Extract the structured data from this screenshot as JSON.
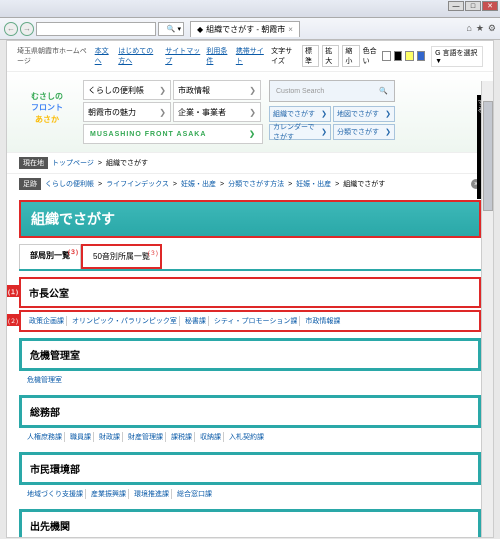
{
  "window": {
    "min": "—",
    "max": "□",
    "close": "✕"
  },
  "tab": {
    "title": "組織でさがす - 朝霞市",
    "close": "×"
  },
  "toolbar": {
    "search_icon": "🔍 ▾",
    "home": "⌂",
    "star": "★",
    "gear": "⚙"
  },
  "topbar": {
    "site_name": "埼玉県朝霞市ホームページ",
    "links": [
      "本文へ",
      "はじめての方へ",
      "サイトマップ",
      "利用条件",
      "携帯サイト"
    ],
    "font_label": "文字サイズ",
    "fonts": [
      "標準",
      "拡大",
      "縮小"
    ],
    "color_label": "色合い",
    "colors": [
      "#fff",
      "#000",
      "#ffff66",
      "#3366cc"
    ],
    "google": "G 言語を選択 ▼"
  },
  "logo": {
    "l1": "むさしの",
    "l2": "フロント",
    "l3": "あさか"
  },
  "nav": [
    [
      "くらしの便利帳",
      "市政情報"
    ],
    [
      "朝霞市の魅力",
      "企業・事業者"
    ]
  ],
  "musashino": "MUSASHINO FRONT ASAKA",
  "custom_search": {
    "placeholder": "Custom Search",
    "icon": "🔍"
  },
  "search_tabs": [
    "組織でさがす",
    "地図でさがす",
    "カレンダーでさがす",
    "分類でさがす"
  ],
  "side_banner": "このページを一時保存する",
  "side_open": "open",
  "bc1": {
    "label": "現在地",
    "items": [
      "トップページ",
      "組織でさがす"
    ]
  },
  "bc2": {
    "label": "足跡",
    "items": [
      "くらしの便利帳",
      "ライフインデックス",
      "妊娠・出産",
      "分類でさがす方法",
      "妊娠・出産",
      "組織でさがす"
    ]
  },
  "page_title": "組織でさがす",
  "tabs": [
    {
      "label": "部局別一覧",
      "badge": "(３)"
    },
    {
      "label": "50音別所属一覧",
      "badge": "(３)"
    }
  ],
  "markers": [
    "(１)",
    "(２)"
  ],
  "sections": [
    {
      "title": "市長公室",
      "items": [
        "政策企画課",
        "オリンピック・パラリンピック室",
        "秘書課",
        "シティ・プロモーション課",
        "市政情報課"
      ]
    },
    {
      "title": "危機管理室",
      "items": [
        "危機管理室"
      ]
    },
    {
      "title": "総務部",
      "items": [
        "人権庶務課",
        "職員課",
        "財政課",
        "財産管理課",
        "課税課",
        "収納課",
        "入札契約課"
      ]
    },
    {
      "title": "市民環境部",
      "items": [
        "地域づくり支援課",
        "産業振興課",
        "環境推進課",
        "総合窓口課"
      ]
    },
    {
      "title": "出先機関",
      "items": []
    }
  ],
  "arrow": "❯"
}
